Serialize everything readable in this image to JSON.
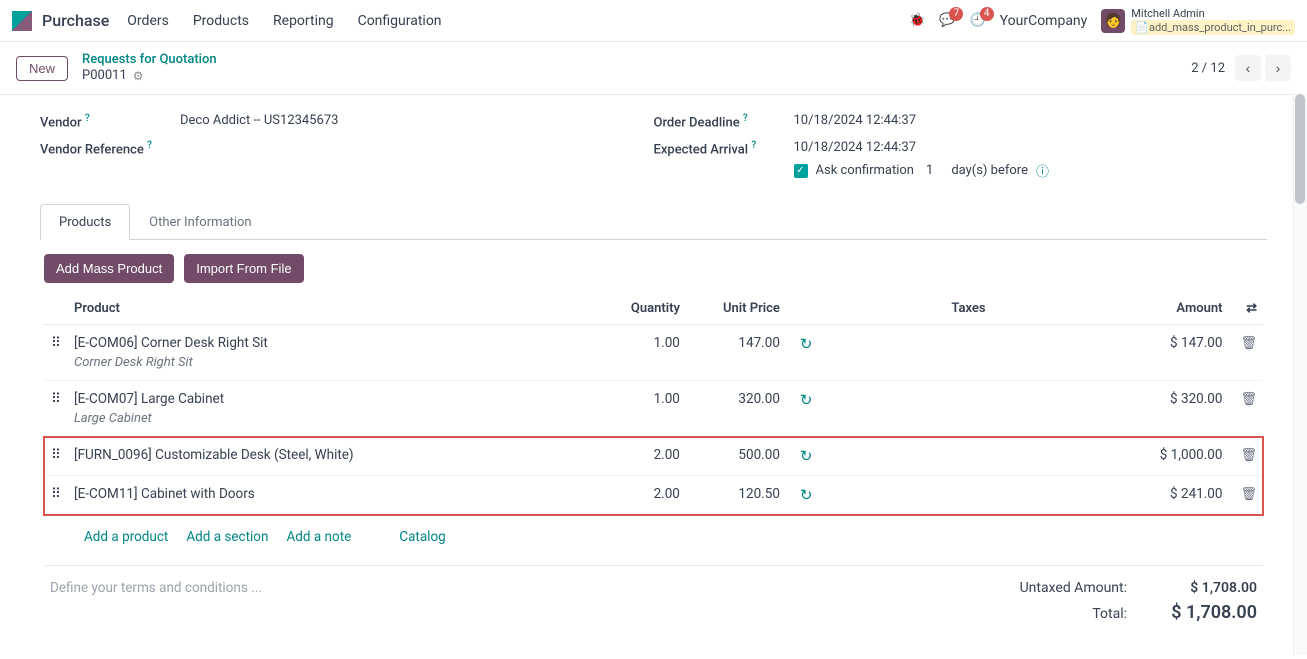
{
  "app": {
    "name": "Purchase"
  },
  "nav": {
    "items": [
      "Orders",
      "Products",
      "Reporting",
      "Configuration"
    ]
  },
  "topbar": {
    "messages_badge": "7",
    "activities_badge": "4",
    "company": "YourCompany",
    "user_name": "Mitchell Admin",
    "user_badge": "📄add_mass_product_in_purc..."
  },
  "breadcrumb": {
    "new_label": "New",
    "parent": "Requests for Quotation",
    "current": "P00011",
    "pager": "2 / 12"
  },
  "form": {
    "vendor_label": "Vendor",
    "vendor_value": "Deco Addict -- US12345673",
    "vendor_ref_label": "Vendor Reference",
    "deadline_label": "Order Deadline",
    "deadline_value": "10/18/2024 12:44:37",
    "arrival_label": "Expected Arrival",
    "arrival_value": "10/18/2024 12:44:37",
    "ask_conf_label": "Ask confirmation",
    "ask_conf_days": "1",
    "ask_conf_after": "day(s) before"
  },
  "tabs": {
    "products": "Products",
    "other": "Other Information"
  },
  "actions": {
    "add_mass": "Add Mass Product",
    "import_file": "Import From File"
  },
  "columns": {
    "product": "Product",
    "quantity": "Quantity",
    "unit_price": "Unit Price",
    "taxes": "Taxes",
    "amount": "Amount"
  },
  "lines": [
    {
      "name": "[E-COM06] Corner Desk Right Sit",
      "desc": "Corner Desk Right Sit",
      "qty": "1.00",
      "price": "147.00",
      "amount": "$ 147.00",
      "highlight": false
    },
    {
      "name": "[E-COM07] Large Cabinet",
      "desc": "Large Cabinet",
      "qty": "1.00",
      "price": "320.00",
      "amount": "$ 320.00",
      "highlight": false
    },
    {
      "name": "[FURN_0096] Customizable Desk (Steel, White)",
      "desc": "",
      "qty": "2.00",
      "price": "500.00",
      "amount": "$ 1,000.00",
      "highlight": true
    },
    {
      "name": "[E-COM11] Cabinet with Doors",
      "desc": "",
      "qty": "2.00",
      "price": "120.50",
      "amount": "$ 241.00",
      "highlight": true
    }
  ],
  "links": {
    "add_product": "Add a product",
    "add_section": "Add a section",
    "add_note": "Add a note",
    "catalog": "Catalog"
  },
  "footer": {
    "terms_placeholder": "Define your terms and conditions ...",
    "untaxed_label": "Untaxed Amount:",
    "untaxed_val": "$ 1,708.00",
    "total_label": "Total:",
    "total_val": "$ 1,708.00"
  }
}
